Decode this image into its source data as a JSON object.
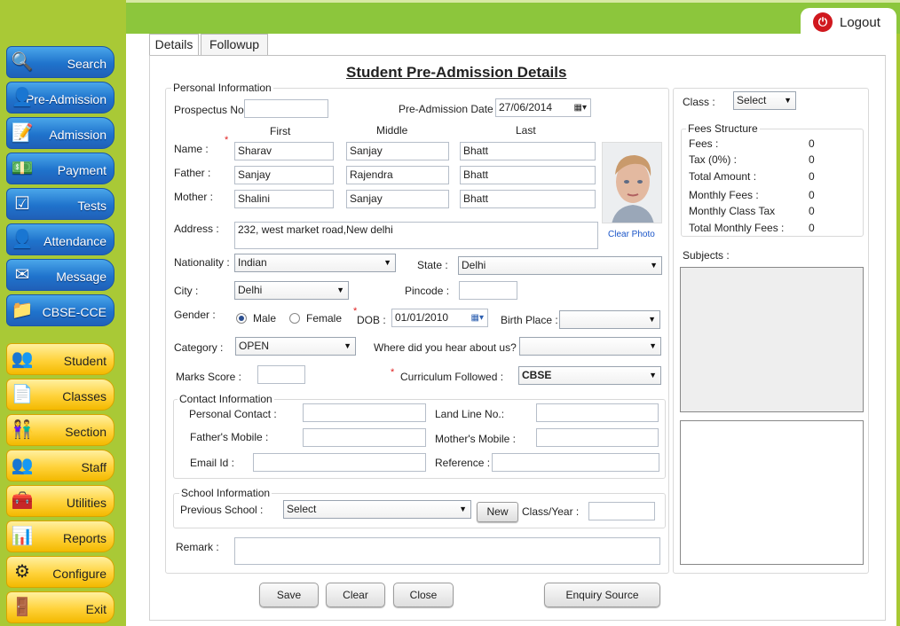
{
  "sidebar": {
    "items": [
      {
        "label": "Search",
        "icon": "search-icon"
      },
      {
        "label": "Pre-Admission",
        "icon": "user-icon"
      },
      {
        "label": "Admission",
        "icon": "edit-icon"
      },
      {
        "label": "Payment",
        "icon": "payment-icon"
      },
      {
        "label": "Tests",
        "icon": "checklist-icon"
      },
      {
        "label": "Attendance",
        "icon": "attendance-icon"
      },
      {
        "label": "Message",
        "icon": "envelope-icon"
      },
      {
        "label": "CBSE-CCE",
        "icon": "folder-icon"
      },
      {
        "label": "Student",
        "icon": "students-icon"
      },
      {
        "label": "Classes",
        "icon": "document-icon"
      },
      {
        "label": "Section",
        "icon": "section-icon"
      },
      {
        "label": "Staff",
        "icon": "staff-icon"
      },
      {
        "label": "Utilities",
        "icon": "utilities-icon"
      },
      {
        "label": "Reports",
        "icon": "reports-icon"
      },
      {
        "label": "Configure",
        "icon": "gear-icon"
      },
      {
        "label": "Exit",
        "icon": "exit-icon"
      }
    ]
  },
  "header": {
    "logout_label": "Logout"
  },
  "tabs": {
    "details": "Details",
    "followup": "Followup"
  },
  "form": {
    "title": "Student Pre-Admission Details",
    "personal_group": "Personal Information",
    "prospectus_label": "Prospectus No.:",
    "prospectus_value": "",
    "preadmission_date_label": "Pre-Admission Date :",
    "preadmission_date_value": "27/06/2014",
    "col_first": "First",
    "col_middle": "Middle",
    "col_last": "Last",
    "name_label": "Name :",
    "father_label": "Father :",
    "mother_label": "Mother :",
    "name": {
      "first": "Sharav",
      "middle": "Sanjay",
      "last": "Bhatt"
    },
    "father": {
      "first": "Sanjay",
      "middle": "Rajendra",
      "last": "Bhatt"
    },
    "mother": {
      "first": "Shalini",
      "middle": "Sanjay",
      "last": "Bhatt"
    },
    "clear_photo": "Clear Photo",
    "address_label": "Address :",
    "address_value": "232, west market road,New delhi",
    "nationality_label": "Nationality :",
    "nationality_value": "Indian",
    "state_label": "State :",
    "state_value": "Delhi",
    "city_label": "City :",
    "city_value": "Delhi",
    "pincode_label": "Pincode :",
    "pincode_value": "",
    "gender_label": "Gender :",
    "gender_male": "Male",
    "gender_female": "Female",
    "dob_label": "DOB :",
    "dob_value": "01/01/2010",
    "birthplace_label": "Birth Place :",
    "birthplace_value": "",
    "category_label": "Category :",
    "category_value": "OPEN",
    "hear_label": "Where did you hear about us?",
    "hear_value": "",
    "marks_label": "Marks Score :",
    "marks_value": "",
    "curriculum_label": "Curriculum Followed :",
    "curriculum_value": "CBSE",
    "contact_group": "Contact Information",
    "personal_contact_label": "Personal Contact :",
    "landline_label": "Land Line No.:",
    "father_mobile_label": "Father's Mobile :",
    "mother_mobile_label": "Mother's Mobile :",
    "email_label": "Email Id :",
    "reference_label": "Reference :",
    "school_group": "School Information",
    "prev_school_label": "Previous School :",
    "prev_school_value": "Select",
    "new_button": "New",
    "class_year_label": "Class/Year :",
    "remark_label": "Remark :"
  },
  "right": {
    "class_label": "Class :",
    "class_value": "Select",
    "fees_group": "Fees Structure",
    "fees": [
      {
        "label": "Fees :",
        "value": "0"
      },
      {
        "label": "Tax (0%) :",
        "value": "0"
      },
      {
        "label": "Total Amount :",
        "value": "0"
      },
      {
        "label": "Monthly Fees :",
        "value": "0"
      },
      {
        "label": "Monthly Class Tax",
        "value": "0"
      },
      {
        "label": "Total Monthly Fees :",
        "value": "0"
      }
    ],
    "subjects_label": "Subjects :"
  },
  "buttons": {
    "save": "Save",
    "clear": "Clear",
    "close": "Close",
    "enquiry": "Enquiry Source"
  },
  "colors": {
    "green": "#8cc63c",
    "sidebar": "#a9c936",
    "blue_button": "#1f73cc",
    "yellow_button": "#ffd23a",
    "required": "#e02020",
    "logout_icon": "#d0181e"
  }
}
